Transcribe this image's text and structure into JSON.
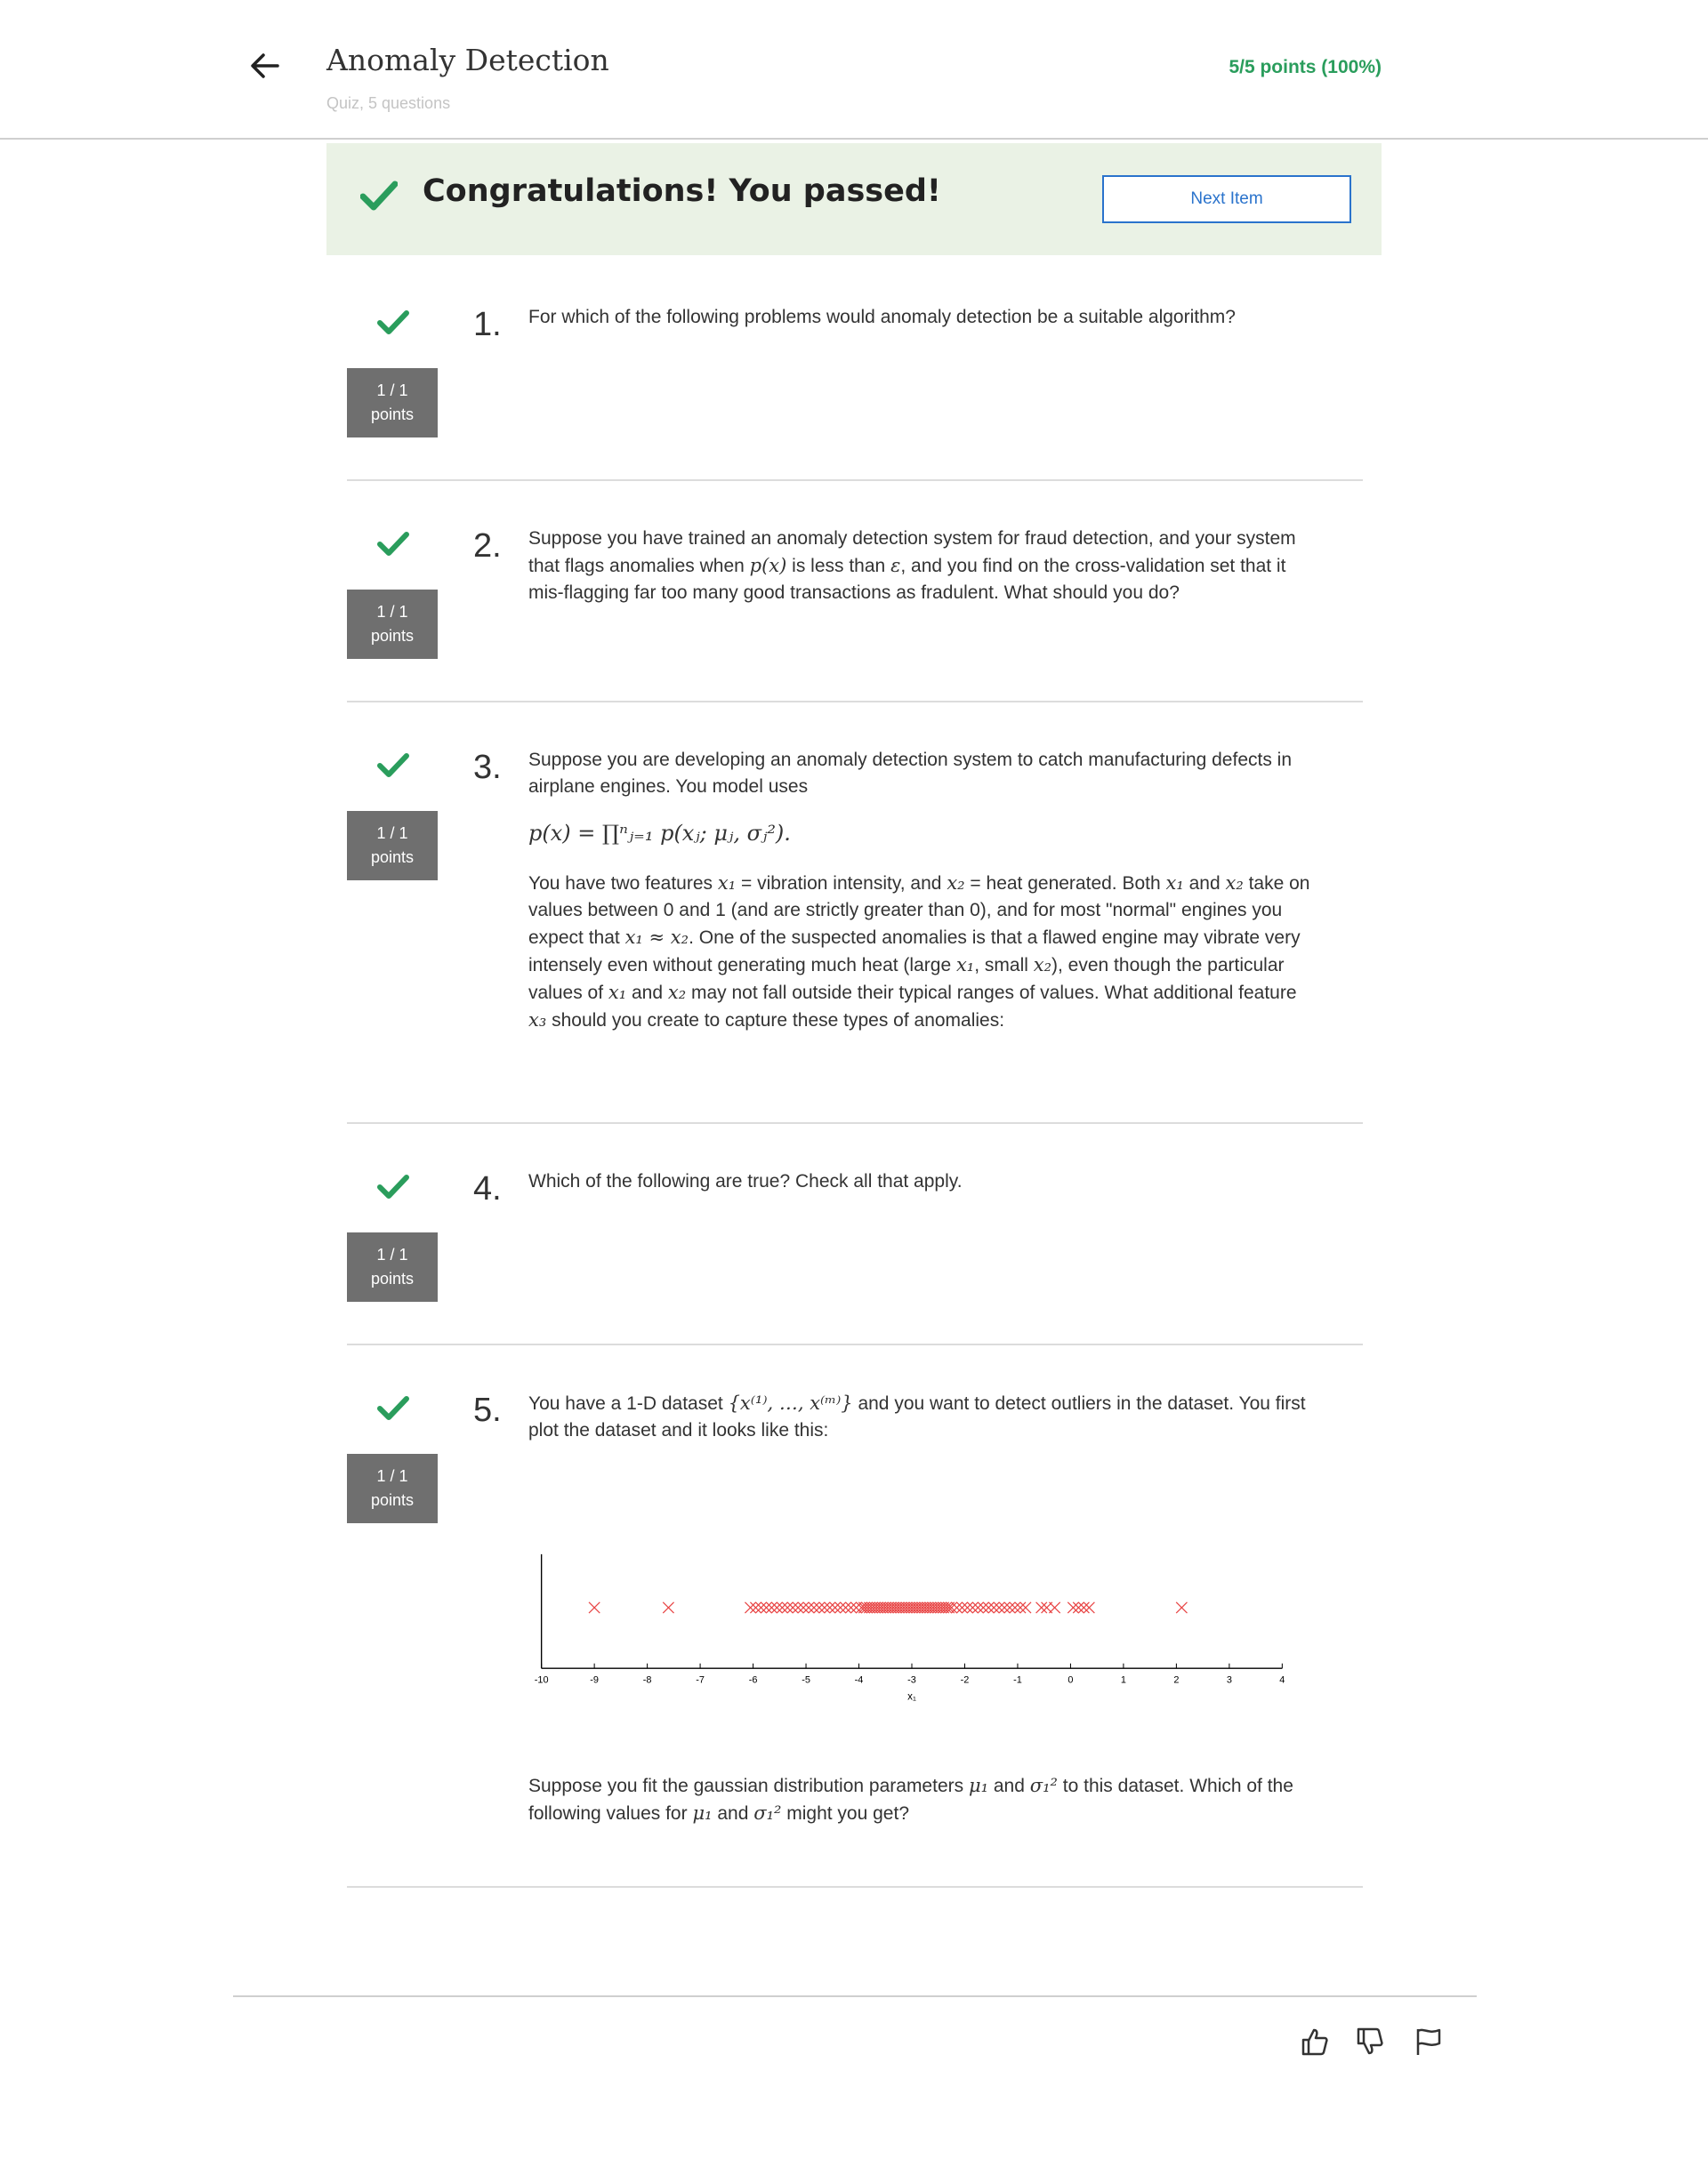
{
  "header": {
    "title": "Anomaly Detection",
    "subtitle": "Quiz, 5 questions",
    "score": "5/5 points (100%)"
  },
  "banner": {
    "message": "Congratulations! You passed!",
    "next_label": "Next Item"
  },
  "questions": [
    {
      "number": "1.",
      "badge_score": "1 / 1",
      "badge_unit": "points",
      "text": "For which of the following problems would anomaly detection be a suitable algorithm?"
    },
    {
      "number": "2.",
      "badge_score": "1 / 1",
      "badge_unit": "points",
      "text_a": "Suppose you have trained an anomaly detection system for fraud detection, and your system that flags anomalies when ",
      "math_a": "p(x)",
      "text_b": " is less than ",
      "math_b": "ε",
      "text_c": ", and you find on the cross-validation set that it mis-flagging far too many good transactions as fradulent. What should you do?"
    },
    {
      "number": "3.",
      "badge_score": "1 / 1",
      "badge_unit": "points",
      "intro": "Suppose you are developing an anomaly detection system to catch manufacturing defects in airplane engines. You model uses",
      "formula": "p(x) = ∏ⁿⱼ₌₁ p(xⱼ; μⱼ, σⱼ²).",
      "p1": "You have two features ",
      "m1": "x₁",
      "p2": " = vibration intensity, and ",
      "m2": "x₂",
      "p3": " = heat generated. Both ",
      "m3": "x₁",
      "p4": " and ",
      "m4": "x₂",
      "p5": " take on values between 0 and 1 (and are strictly greater than 0), and for most \"normal\" engines you expect that ",
      "m5": "x₁ ≈ x₂",
      "p6": ". One of the suspected anomalies is that a flawed engine may vibrate very intensely even without generating much heat (large ",
      "m6": "x₁",
      "p7": ", small ",
      "m7": "x₂",
      "p8": "), even though the particular values of ",
      "m8": "x₁",
      "p9": " and ",
      "m9": "x₂",
      "p10": " may not fall outside their typical ranges of values. What additional feature ",
      "m10": "x₃",
      "p11": " should you create to capture these types of anomalies:"
    },
    {
      "number": "4.",
      "badge_score": "1 / 1",
      "badge_unit": "points",
      "text": "Which of the following are true? Check all that apply."
    },
    {
      "number": "5.",
      "badge_score": "1 / 1",
      "badge_unit": "points",
      "t1": "You have a 1-D dataset ",
      "m1": "{x⁽¹⁾, …, x⁽ᵐ⁾}",
      "t2": " and you want to detect outliers in the dataset. You first plot the dataset and it looks like this:",
      "f1": "Suppose you fit the gaussian distribution parameters ",
      "fm1": "μ₁",
      "f2": " and ",
      "fm2": "σ₁²",
      "f3": " to this dataset. Which of the following values for ",
      "fm3": "μ₁",
      "f4": " and ",
      "fm4": "σ₁²",
      "f5": " might you get?"
    }
  ],
  "chart_data": {
    "type": "scatter",
    "xlabel": "x₁",
    "xlim": [
      -10,
      4
    ],
    "x_ticks": [
      "-10",
      "-9",
      "-8",
      "-7",
      "-6",
      "-5",
      "-4",
      "-3",
      "-2",
      "-1",
      "0",
      "1",
      "2",
      "3",
      "4"
    ],
    "marker": "x",
    "color": "#e84545",
    "points_x": [
      -9.0,
      -7.6,
      -6.05,
      -5.95,
      -5.85,
      -5.75,
      -5.65,
      -5.55,
      -5.45,
      -5.35,
      -5.25,
      -5.15,
      -5.05,
      -4.95,
      -4.85,
      -4.75,
      -4.65,
      -4.55,
      -4.45,
      -4.35,
      -4.25,
      -4.15,
      -4.05,
      -3.95,
      -3.9,
      -3.85,
      -3.8,
      -3.75,
      -3.7,
      -3.65,
      -3.6,
      -3.55,
      -3.5,
      -3.45,
      -3.4,
      -3.35,
      -3.3,
      -3.25,
      -3.2,
      -3.15,
      -3.1,
      -3.05,
      -3.0,
      -2.95,
      -2.9,
      -2.85,
      -2.8,
      -2.75,
      -2.7,
      -2.65,
      -2.6,
      -2.55,
      -2.5,
      -2.45,
      -2.4,
      -2.35,
      -2.3,
      -2.25,
      -2.15,
      -2.05,
      -1.95,
      -1.85,
      -1.75,
      -1.65,
      -1.55,
      -1.45,
      -1.35,
      -1.25,
      -1.15,
      -1.05,
      -0.95,
      -0.85,
      -0.55,
      -0.45,
      -0.3,
      0.05,
      0.15,
      0.25,
      0.35,
      2.1
    ]
  },
  "footer": {
    "icons": [
      "thumbs-up-icon",
      "thumbs-down-icon",
      "flag-icon"
    ]
  }
}
